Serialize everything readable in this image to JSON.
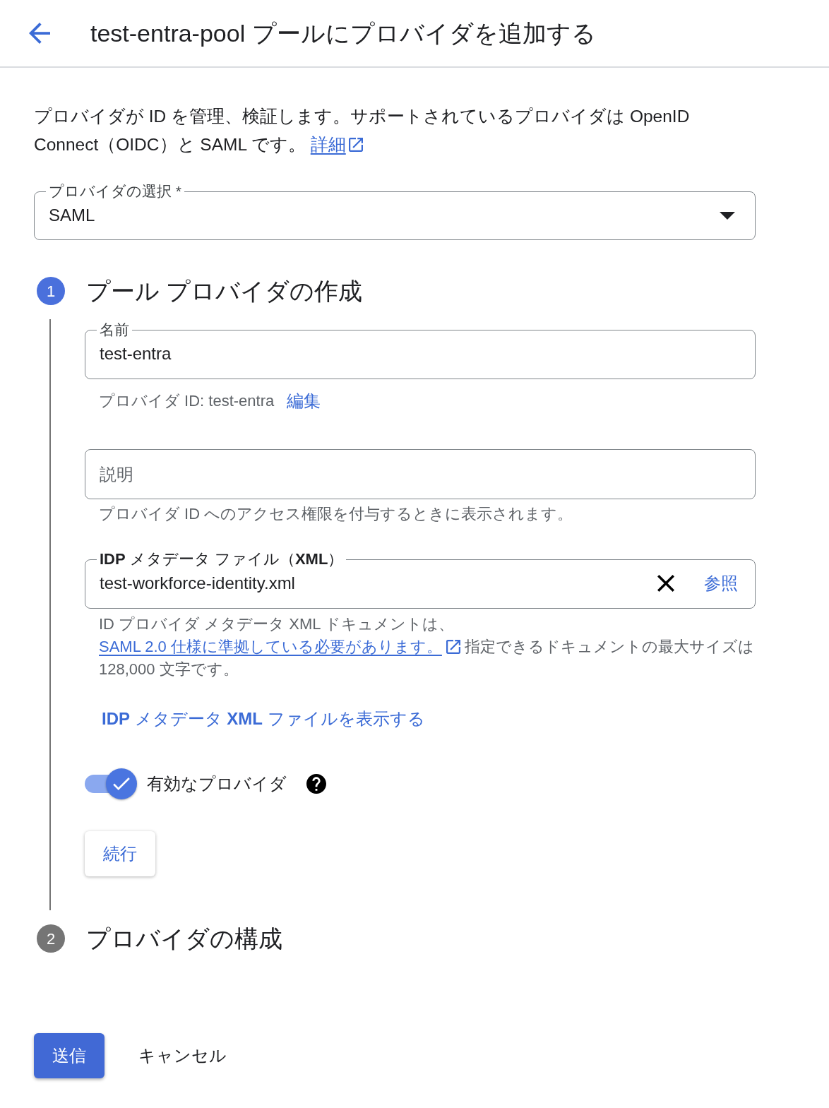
{
  "header": {
    "title": "test-entra-pool プールにプロバイダを追加する"
  },
  "intro": {
    "text": "プロバイダが ID を管理、検証します。サポートされているプロバイダは OpenID Connect（OIDC）と SAML です。",
    "link": "詳細"
  },
  "provider_select": {
    "label": "プロバイダの選択 *",
    "value": "SAML"
  },
  "steps": [
    {
      "number": "1",
      "title": "プール プロバイダの作成",
      "active": true
    },
    {
      "number": "2",
      "title": "プロバイダの構成",
      "active": false
    }
  ],
  "form": {
    "name_field": {
      "label": "名前",
      "value": "test-entra"
    },
    "provider_id": {
      "text": "プロバイダ ID: test-entra",
      "edit_link": "編集"
    },
    "description_field": {
      "placeholder": "説明",
      "hint": "プロバイダ ID へのアクセス権限を付与するときに表示されます。"
    },
    "metadata_field": {
      "label": "**IDP** メタデータ ファイル（**XML**）",
      "value": "test-workforce-identity.xml",
      "browse_button": "参照"
    },
    "metadata_hint": {
      "text_before": "ID プロバイダ メタデータ XML ドキュメントは、",
      "link": "SAML 2.0 仕様に準拠している必要があります。",
      "text_after": "指定できるドキュメントの最大サイズは 128,000 文字です。"
    },
    "view_xml_link": "**IDP** メタデータ **XML** ファイルを表示する",
    "enabled_toggle": {
      "label": "有効なプロバイダ",
      "on": true
    },
    "continue_button": "続行"
  },
  "actions": {
    "submit": "送信",
    "cancel": "キャンセル"
  }
}
